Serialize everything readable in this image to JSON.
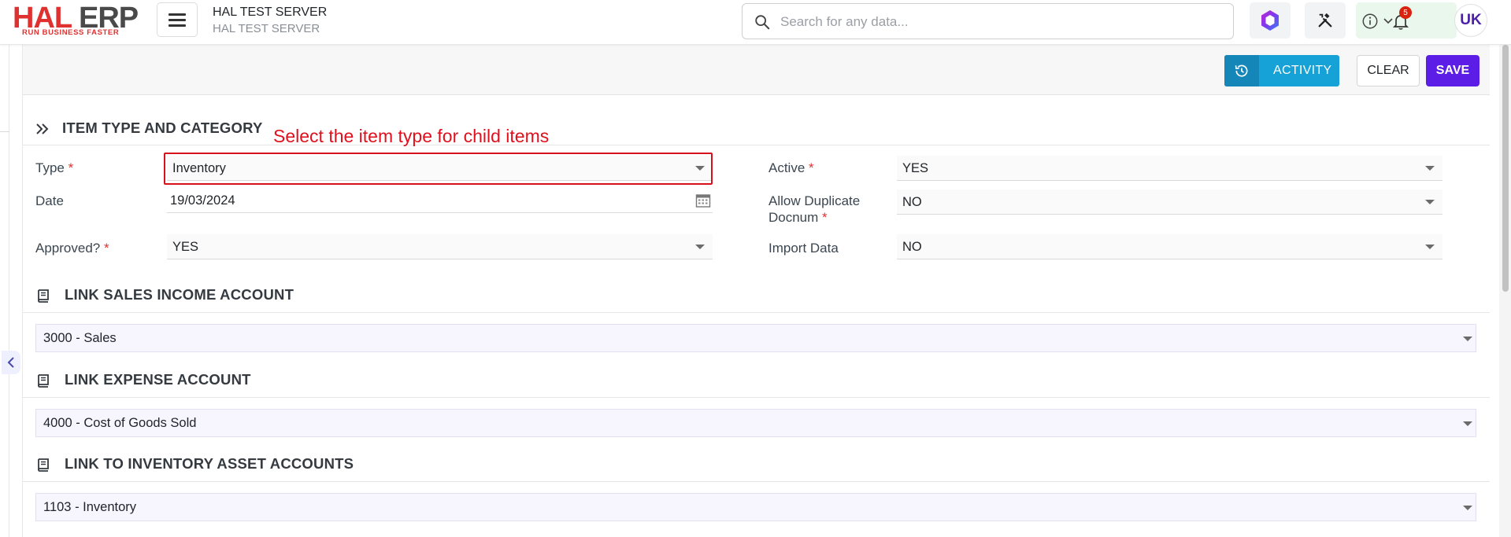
{
  "app": {
    "logo_text_primary": "HAL",
    "logo_text_secondary": "ERP",
    "logo_tagline": "RUN BUSINESS FASTER",
    "server_title": "HAL TEST SERVER",
    "server_subtitle": "HAL TEST SERVER"
  },
  "search": {
    "placeholder": "Search for any data..."
  },
  "header": {
    "notification_count": "5",
    "user_initials": "UK"
  },
  "actions": {
    "activity_label": "ACTIVITY",
    "clear_label": "CLEAR",
    "save_label": "SAVE"
  },
  "sections": {
    "item_type": {
      "title": "ITEM TYPE AND CATEGORY",
      "type_label": "Type",
      "type_value": "Inventory",
      "date_label": "Date",
      "date_value": "19/03/2024",
      "approved_label": "Approved?",
      "approved_value": "YES",
      "active_label": "Active",
      "active_value": "YES",
      "allow_dup_label_line1": "Allow Duplicate",
      "allow_dup_label_line2": "Docnum",
      "allow_dup_value": "NO",
      "import_label": "Import Data",
      "import_value": "NO"
    },
    "sales": {
      "title": "LINK SALES INCOME ACCOUNT",
      "value": "3000 - Sales"
    },
    "expense": {
      "title": "LINK EXPENSE ACCOUNT",
      "value": "4000 - Cost of Goods Sold"
    },
    "inventory": {
      "title": "LINK TO INVENTORY ASSET ACCOUNTS",
      "value": "1103 - Inventory"
    }
  },
  "annotation": {
    "text": "Select the item type for child items"
  },
  "required_marker": "*",
  "colors": {
    "brand_red": "#e03131",
    "save_purple": "#5c1ee6",
    "activity_blue": "#16a2d7",
    "annotation_red": "#e0101e"
  }
}
